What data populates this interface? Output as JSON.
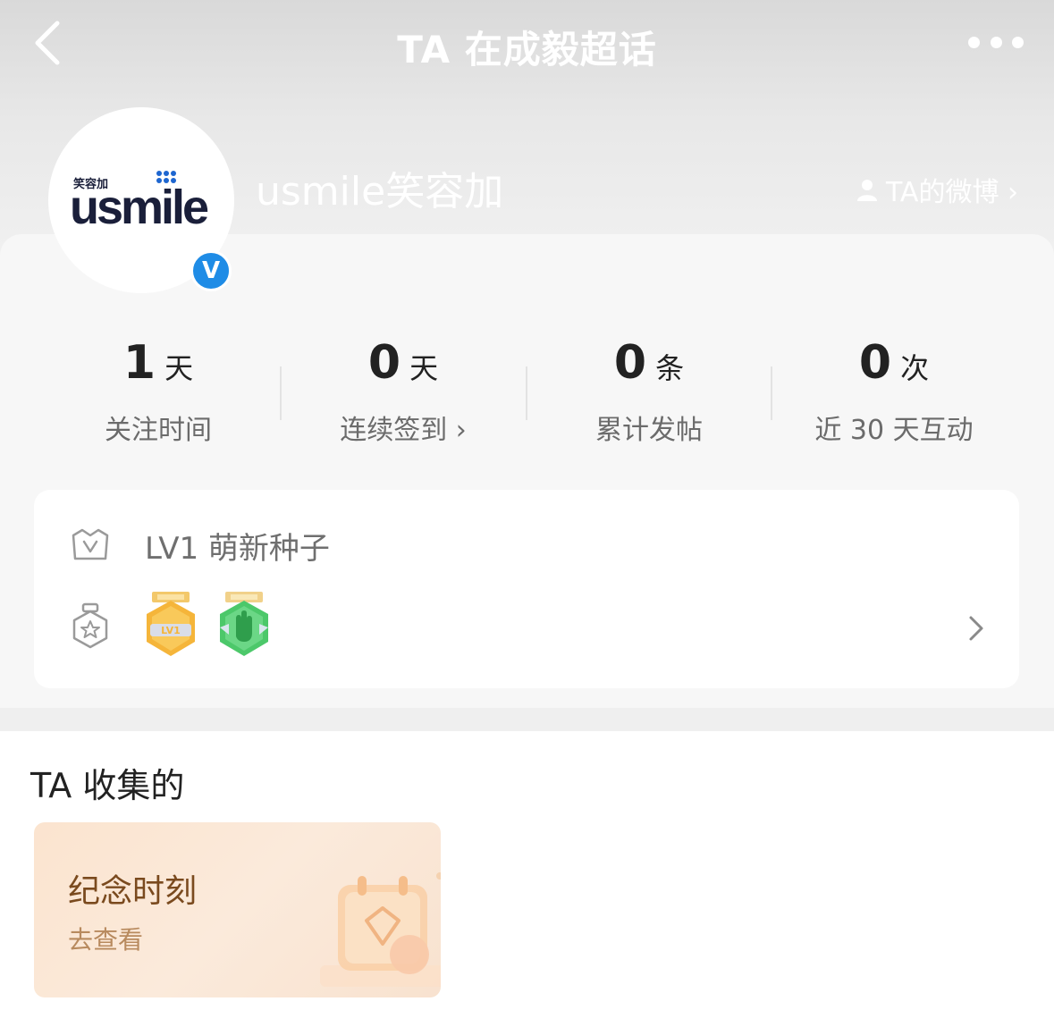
{
  "nav": {
    "title": "TA 在成毅超话"
  },
  "profile": {
    "name": "usmile笑容加",
    "logo_cn": "笑容加",
    "logo_en": "usmile",
    "verified_label": "V",
    "weibo_link": "TA的微博 ›"
  },
  "stats": [
    {
      "value": "1",
      "unit": "天",
      "label": "关注时间"
    },
    {
      "value": "0",
      "unit": "天",
      "label": "连续签到 ›"
    },
    {
      "value": "0",
      "unit": "条",
      "label": "累计发帖"
    },
    {
      "value": "0",
      "unit": "次",
      "label": "近 30 天互动"
    }
  ],
  "level": {
    "text": "LV1 萌新种子",
    "badge_lv_text": "LV1"
  },
  "collection": {
    "title": "TA 收集的",
    "card_title": "纪念时刻",
    "card_action": "去查看"
  },
  "colors": {
    "verified": "#1f8ce6",
    "logo_dark": "#1a1f3a",
    "logo_blue": "#1e66d0",
    "badge_gold": "#f5b53a",
    "badge_green": "#4cc86a",
    "memory_title": "#7a4a1e"
  }
}
